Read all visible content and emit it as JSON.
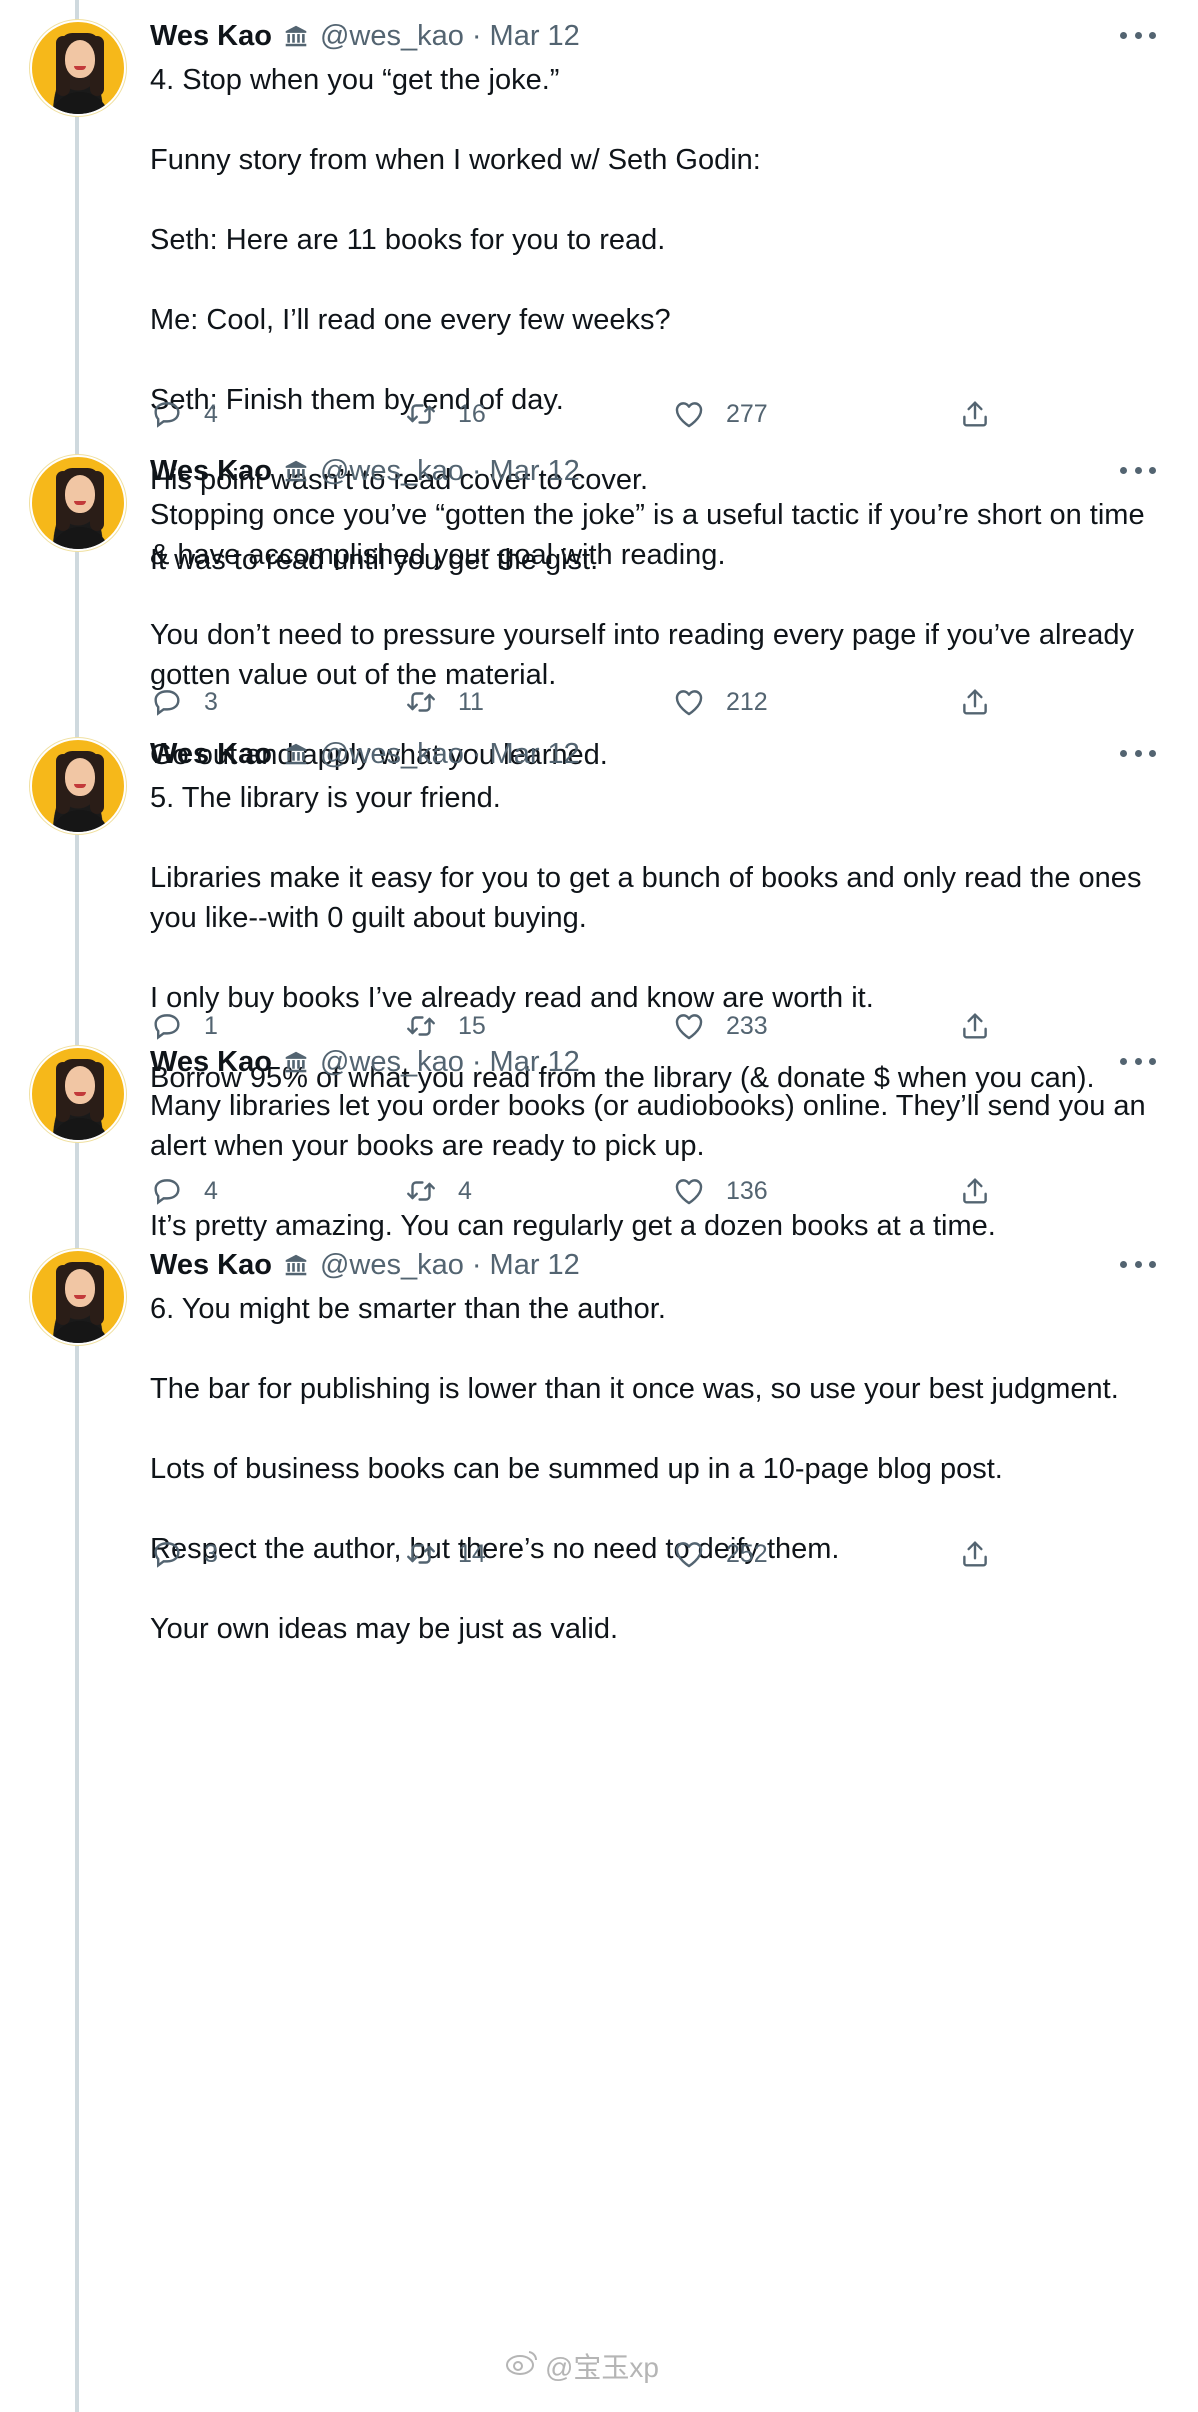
{
  "author": {
    "name": "Wes Kao",
    "org_icon": "government-building-icon",
    "handle": "@wes_kao",
    "separator": "·",
    "date": "Mar 12"
  },
  "tweets": [
    {
      "paragraphs": [
        "4. Stop when you “get the joke.”",
        "Funny story from when I worked w/ Seth Godin:",
        "Seth: Here are 11 books for you to read.",
        "Me: Cool, I’ll read one every few weeks?",
        "Seth: Finish them by end of day.",
        "His point wasn’t to read cover to cover.",
        "It was to read until you get the gist."
      ],
      "replies": "4",
      "retweets": "16",
      "likes": "277"
    },
    {
      "paragraphs": [
        "Stopping once you’ve “gotten the joke” is a useful tactic if you’re short on time & have accomplished your goal with reading.",
        "You don’t need to pressure yourself into reading every page if you’ve already gotten value out of the material.",
        "Go out and apply what you learned."
      ],
      "replies": "3",
      "retweets": "11",
      "likes": "212"
    },
    {
      "paragraphs": [
        "5. The library is your friend.",
        "Libraries make it easy for you to get a bunch of books and only read the ones you like--with 0 guilt about buying.",
        "I only buy books I’ve already read and know are worth it.",
        "Borrow 95% of what you read from the library (& donate $ when you can)."
      ],
      "replies": "1",
      "retweets": "15",
      "likes": "233"
    },
    {
      "paragraphs": [
        "Many libraries let you order books (or audiobooks) online. They’ll send you an alert when your books are ready to pick up.",
        "It’s pretty amazing. You can regularly get a dozen books at a time."
      ],
      "replies": "4",
      "retweets": "4",
      "likes": "136"
    },
    {
      "paragraphs": [
        "6. You might be smarter than the author.",
        "The bar for publishing is lower than it once was, so use your best judgment.",
        "Lots of business books can be summed up in a 10-page blog post.",
        "Respect the author, but there’s no need to deify them.",
        "Your own ideas may be just as valid."
      ],
      "replies": "3",
      "retweets": "14",
      "likes": "252"
    }
  ],
  "watermark": {
    "text": "@宝玉xp",
    "icon": "weibo-icon"
  },
  "colors": {
    "text": "#0f1419",
    "secondary": "#536471",
    "thread_line": "#cfd9de",
    "avatar_bg": "#f6b81a"
  }
}
